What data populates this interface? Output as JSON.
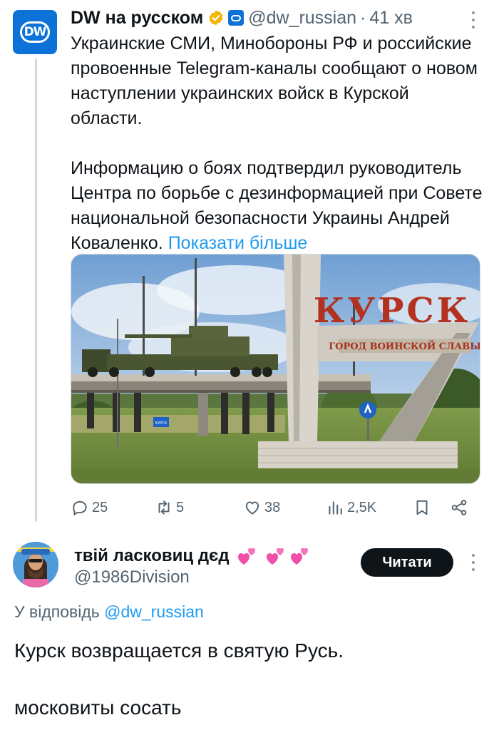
{
  "tweet": {
    "author_name": "DW на русском",
    "handle": "@dw_russian",
    "separator": "·",
    "time": "41 хв",
    "paragraph1": "Украинские СМИ, Минобороны РФ и российские провоенные Telegram-каналы сообщают о новом наступлении украинских войск в Курской области.",
    "paragraph2": "Информацию о боях подтвердил руководитель Центра по борьбе с дезинформацией при Совете национальной безопасности Украины Андрей Коваленко.",
    "show_more": "Показати більше",
    "avatar_text": "DW",
    "image": {
      "sign_text": "КУРСК",
      "sign_subtext": "ГОРОД ВОИНСКОЙ СЛАВЫ",
      "road_sign_text": "КУРСК"
    },
    "actions": {
      "replies": "25",
      "reposts": "5",
      "likes": "38",
      "views": "2,5K"
    },
    "colors": {
      "accent": "#1d9bf0",
      "dw_blue": "#0c72d8",
      "gold_badge": "#f4b400"
    }
  },
  "reply": {
    "author_name": "твій ласковиц дєд",
    "handle": "@1986Division",
    "follow_label": "Читати",
    "replying_prefix": "У відповідь",
    "replying_to": "@dw_russian",
    "line1": "Курск возвращается в святую Русь.",
    "line2": "московиты сосать"
  }
}
